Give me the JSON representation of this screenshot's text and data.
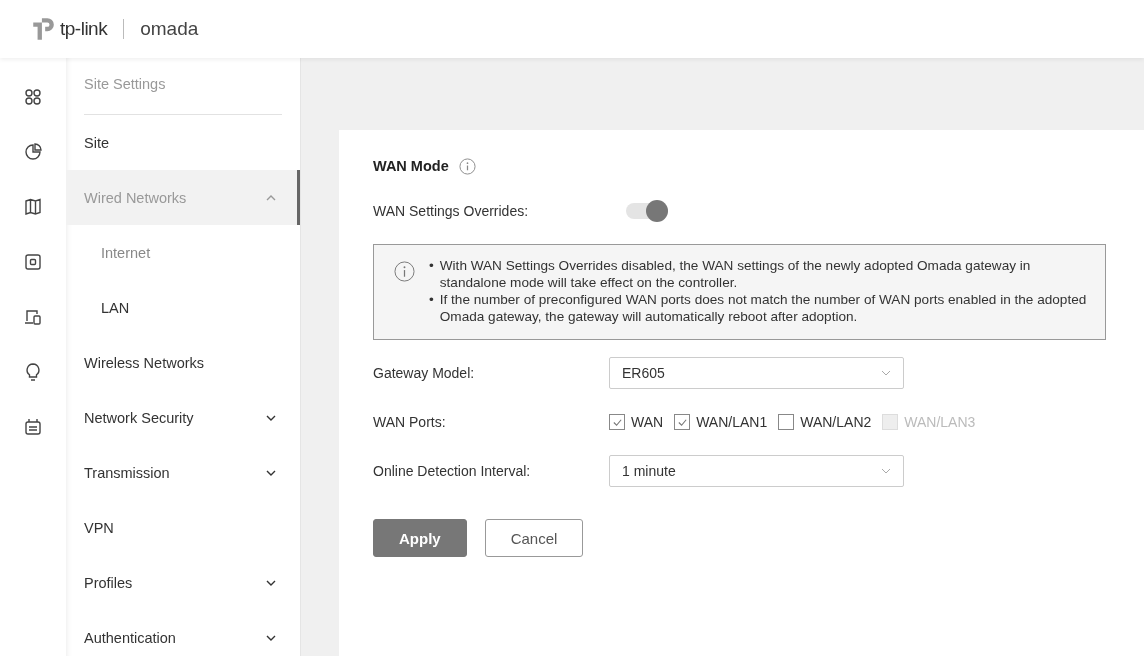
{
  "header": {
    "brand": "tp-link",
    "product": "omada"
  },
  "sidebar": {
    "title": "Site Settings",
    "items": [
      {
        "label": "Site",
        "selected": false,
        "kind": "link"
      },
      {
        "label": "Wired Networks",
        "selected": true,
        "kind": "group",
        "expanded": true,
        "children": [
          {
            "label": "Internet",
            "selected": true
          },
          {
            "label": "LAN",
            "selected": false
          }
        ]
      },
      {
        "label": "Wireless Networks",
        "selected": false,
        "kind": "link"
      },
      {
        "label": "Network Security",
        "selected": false,
        "kind": "group",
        "expanded": false
      },
      {
        "label": "Transmission",
        "selected": false,
        "kind": "group",
        "expanded": false
      },
      {
        "label": "VPN",
        "selected": false,
        "kind": "link"
      },
      {
        "label": "Profiles",
        "selected": false,
        "kind": "group",
        "expanded": false
      },
      {
        "label": "Authentication",
        "selected": false,
        "kind": "group",
        "expanded": false
      }
    ]
  },
  "form": {
    "title": "WAN Mode",
    "override": {
      "label": "WAN Settings Overrides:",
      "on": true
    },
    "notice": [
      {
        "marker": "•",
        "text": "With WAN Settings Overrides disabled, the WAN settings of the newly adopted Omada gateway in standalone mode will take effect on the controller."
      },
      {
        "marker": "•",
        "text": "If the number of preconfigured WAN ports does not match the number of WAN ports enabled in the adopted Omada gateway, the gateway will automatically reboot after adoption."
      }
    ],
    "gateway_model": {
      "label": "Gateway Model:",
      "value": "ER605"
    },
    "wan_ports": {
      "label": "WAN Ports:",
      "options": [
        {
          "label": "WAN",
          "checked": true,
          "disabled": false
        },
        {
          "label": "WAN/LAN1",
          "checked": true,
          "disabled": false
        },
        {
          "label": "WAN/LAN2",
          "checked": false,
          "disabled": false
        },
        {
          "label": "WAN/LAN3",
          "checked": false,
          "disabled": true
        }
      ]
    },
    "detection_interval": {
      "label": "Online Detection Interval:",
      "value": "1 minute"
    },
    "buttons": [
      {
        "label": "Apply",
        "kind": "primary"
      },
      {
        "label": "Cancel",
        "kind": "secondary"
      }
    ]
  }
}
